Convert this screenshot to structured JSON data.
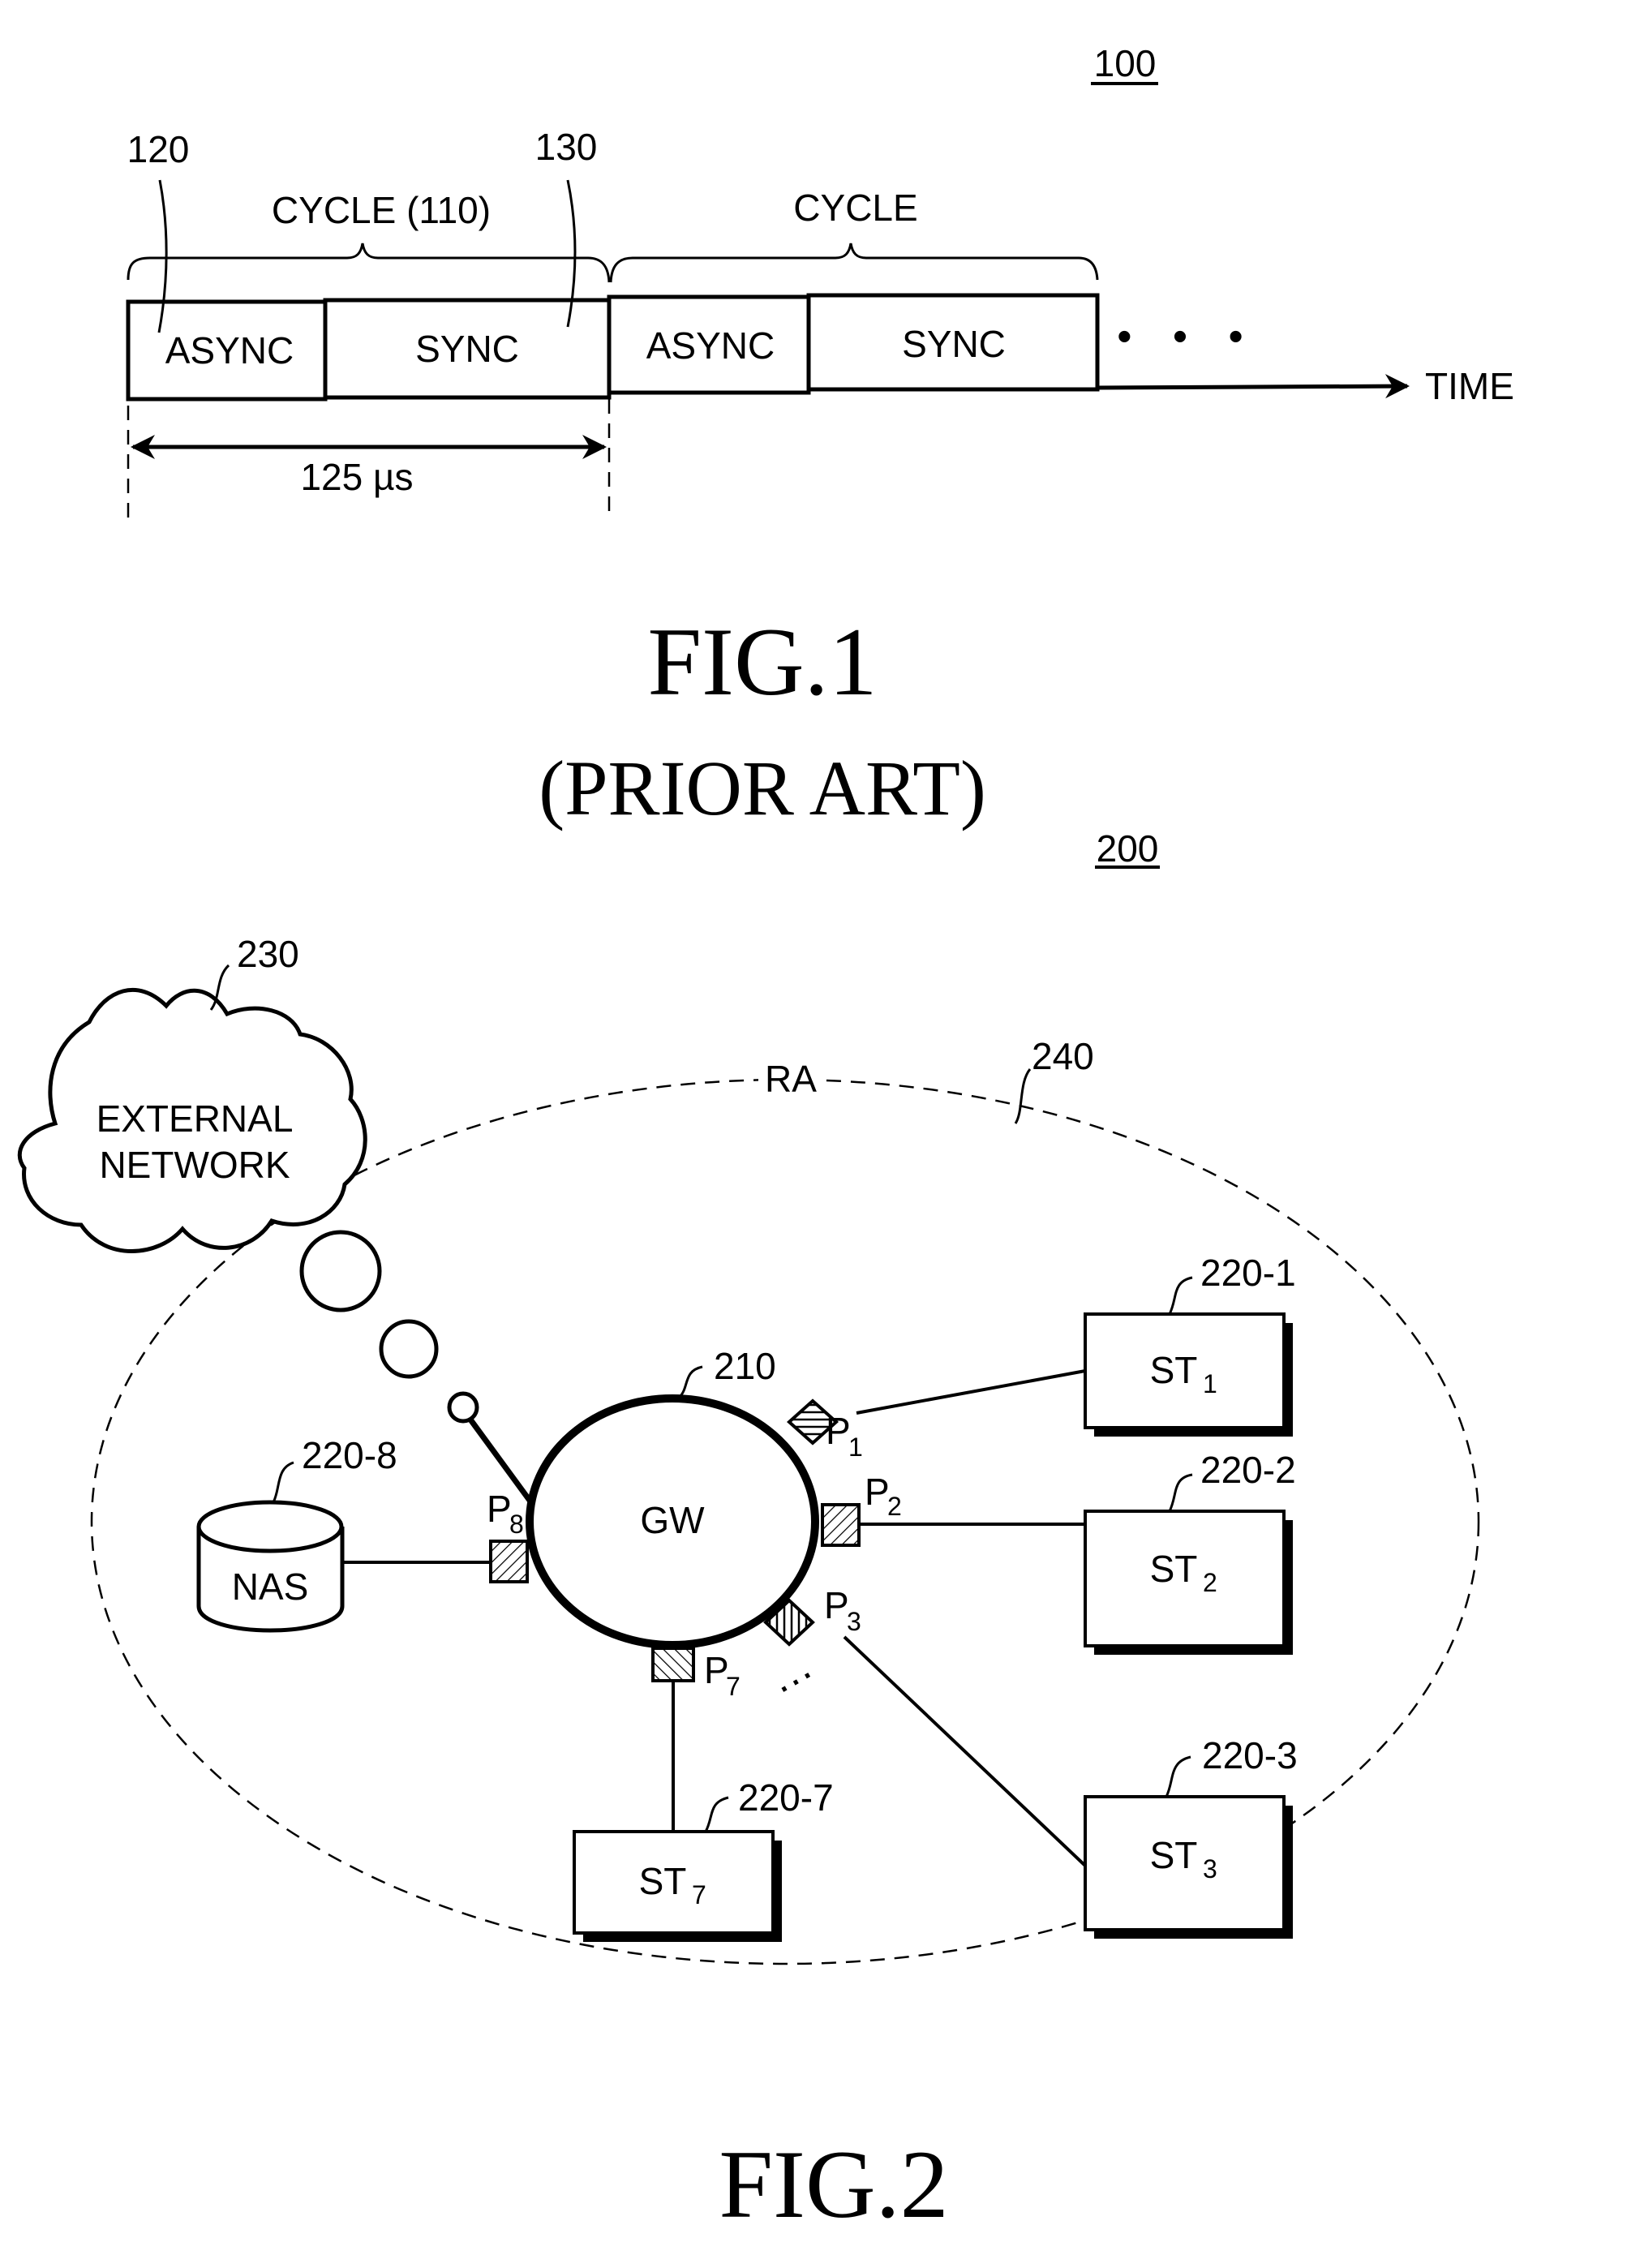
{
  "fig1": {
    "ref_number": "100",
    "cycle_labels": [
      "CYCLE (110)",
      "CYCLE"
    ],
    "callouts": {
      "async_ref": "120",
      "sync_ref": "130"
    },
    "segments": [
      {
        "label": "ASYNC"
      },
      {
        "label": "SYNC"
      },
      {
        "label": "ASYNC"
      },
      {
        "label": "SYNC"
      }
    ],
    "ellipsis": "• • •",
    "axis_label": "TIME",
    "duration_label": "125 µs",
    "caption": "FIG.1",
    "caption_sub": "(PRIOR ART)"
  },
  "fig2": {
    "ref_number": "200",
    "external_network": {
      "line1": "EXTERNAL",
      "line2": "NETWORK",
      "ref": "230"
    },
    "region": {
      "label": "RA",
      "ref": "240"
    },
    "gateway": {
      "label": "GW",
      "ref": "210"
    },
    "nas": {
      "label": "NAS",
      "ref": "220-8"
    },
    "ports": {
      "p1": {
        "main": "P",
        "sub": "1"
      },
      "p2": {
        "main": "P",
        "sub": "2"
      },
      "p3": {
        "main": "P",
        "sub": "3"
      },
      "p7": {
        "main": "P",
        "sub": "7"
      },
      "p8": {
        "main": "P",
        "sub": "8"
      }
    },
    "stations": [
      {
        "main": "ST",
        "sub": "1",
        "ref": "220-1"
      },
      {
        "main": "ST",
        "sub": "2",
        "ref": "220-2"
      },
      {
        "main": "ST",
        "sub": "3",
        "ref": "220-3"
      },
      {
        "main": "ST",
        "sub": "7",
        "ref": "220-7"
      }
    ],
    "port_ellipsis": "…",
    "caption": "FIG.2"
  }
}
